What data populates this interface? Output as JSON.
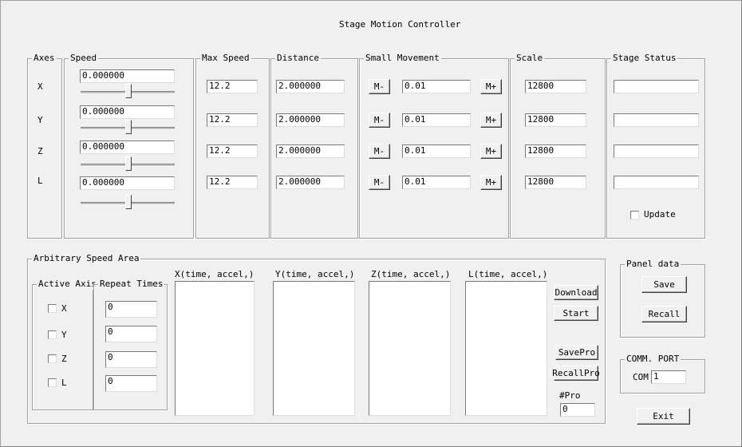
{
  "window": {
    "title": "Stage Motion Controller"
  },
  "axes_group": {
    "title": "Axes",
    "labels": [
      "X",
      "Y",
      "Z",
      "L"
    ]
  },
  "speed_group": {
    "title": "Speed",
    "values": [
      "0.000000",
      "0.000000",
      "0.000000",
      "0.000000"
    ]
  },
  "max_speed_group": {
    "title": "Max Speed",
    "values": [
      "12.2",
      "12.2",
      "12.2",
      "12.2"
    ]
  },
  "distance_group": {
    "title": "Distance",
    "values": [
      "2.000000",
      "2.000000",
      "2.000000",
      "2.000000"
    ]
  },
  "small_movement_group": {
    "title": "Small Movement",
    "minus_label": "M-",
    "plus_label": "M+",
    "values": [
      "0.01",
      "0.01",
      "0.01",
      "0.01"
    ]
  },
  "scale_group": {
    "title": "Scale",
    "values": [
      "12800",
      "12800",
      "12800",
      "12800"
    ]
  },
  "stage_status_group": {
    "title": "Stage Status",
    "values": [
      "",
      "",
      "",
      ""
    ],
    "update_label": "Update"
  },
  "arbitrary": {
    "title": "Arbitrary Speed Area",
    "active_axis_title": "Active Axis",
    "axis_labels": [
      "X",
      "Y",
      "Z",
      "L"
    ],
    "repeat_times_title": "Repeat Times",
    "repeat_values": [
      "0",
      "0",
      "0",
      "0"
    ],
    "list_headers": [
      "X(time, accel,)",
      "Y(time, accel,)",
      "Z(time, accel,)",
      "L(time, accel,)"
    ],
    "download_label": "Download",
    "start_label": "Start",
    "savepro_label": "SavePro",
    "recallpro_label": "RecallPro",
    "pro_label": "#Pro",
    "pro_value": "0"
  },
  "panel_data": {
    "title": "Panel data",
    "save_label": "Save",
    "recall_label": "Recall"
  },
  "comm_port": {
    "title": "COMM. PORT",
    "com_label": "COM",
    "com_value": "1"
  },
  "exit_label": "Exit"
}
